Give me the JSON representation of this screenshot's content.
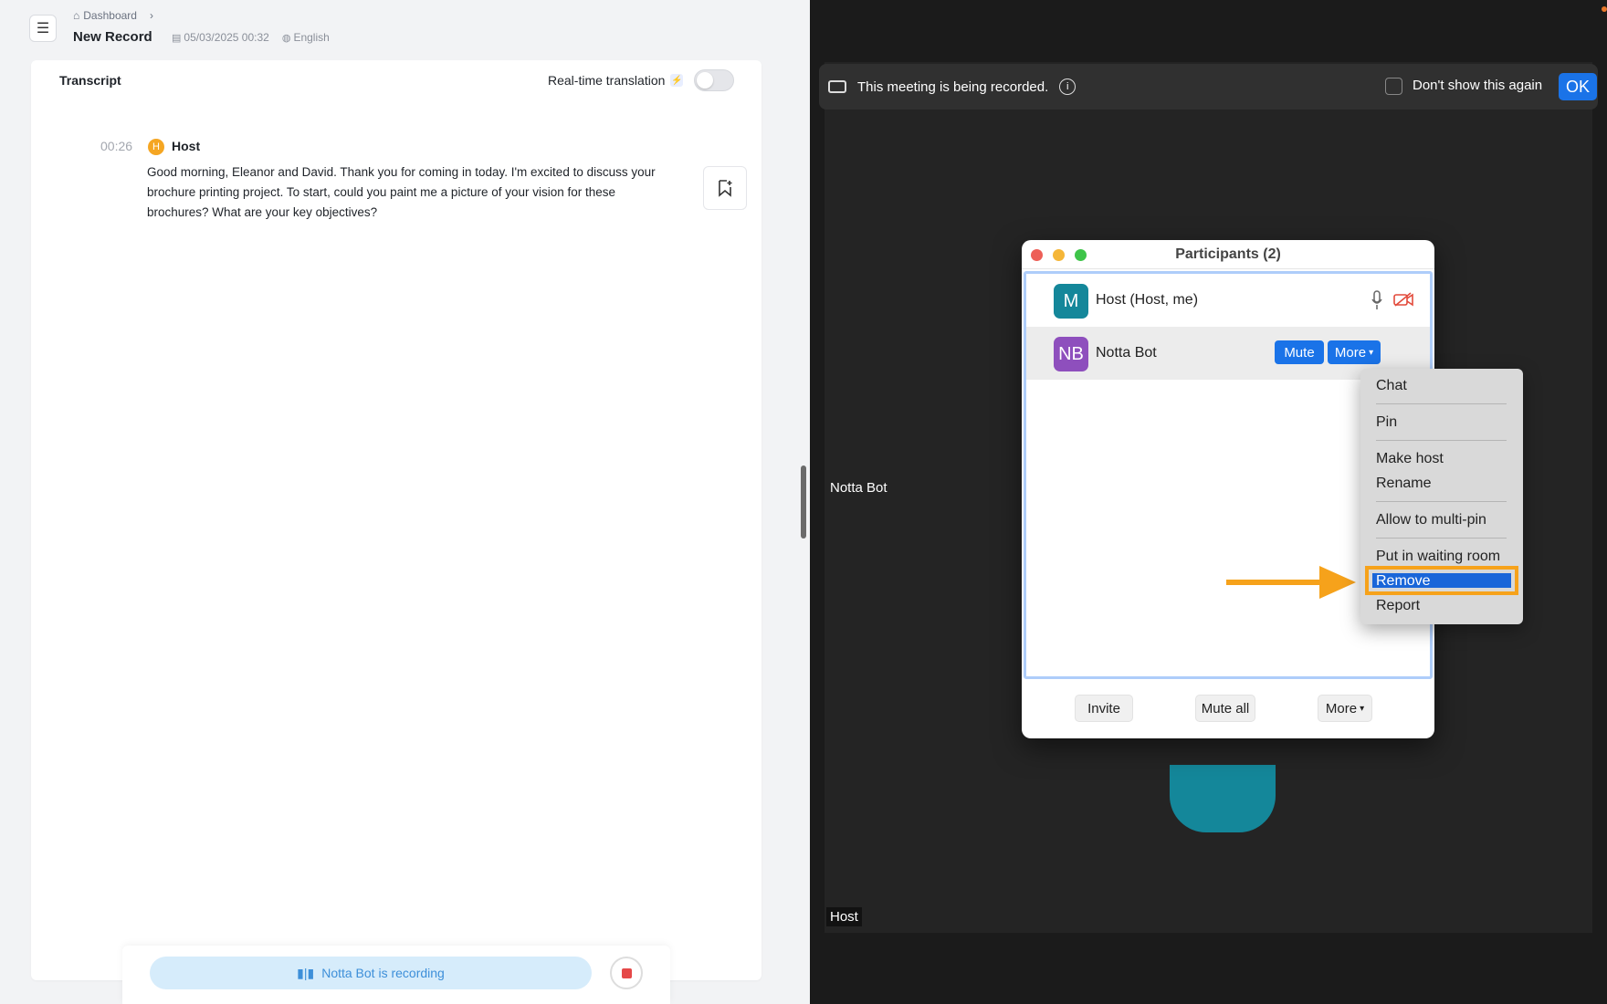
{
  "notta": {
    "breadcrumb": "Dashboard",
    "title": "New Record",
    "date": "05/03/2025 00:32",
    "language": "English",
    "tab": "Transcript",
    "realtime_label": "Real-time translation",
    "entry": {
      "time": "00:26",
      "speaker_initial": "H",
      "speaker": "Host",
      "text": "Good morning, Eleanor and David. Thank you for coming in today. I'm excited to discuss your brochure printing project. To start, could you paint me a picture of your vision for these brochures? What are your key objectives?"
    },
    "recording_status": "Notta Bot is recording",
    "accent": "#3d8fd9"
  },
  "zoom": {
    "banner_msg": "This meeting is being recorded.",
    "dont_show": "Don't show this again",
    "ok": "OK",
    "tile_notta": "Notta Bot",
    "tile_host": "Host",
    "participants_title": "Participants (2)",
    "participants": [
      {
        "initials": "M",
        "name": "Host (Host, me)",
        "color": "#14879a"
      },
      {
        "initials": "NB",
        "name": "Notta Bot",
        "color": "#8e4fbd"
      }
    ],
    "mute_label": "Mute",
    "more_label": "More",
    "footer": {
      "invite": "Invite",
      "mute_all": "Mute all",
      "more": "More"
    },
    "context_menu": [
      "Chat",
      "Pin",
      "Make host",
      "Rename",
      "Allow to multi-pin",
      "Put in waiting room",
      "Remove",
      "Report"
    ],
    "highlight_color": "#f6a21b",
    "selected_color": "#1a66d9"
  }
}
